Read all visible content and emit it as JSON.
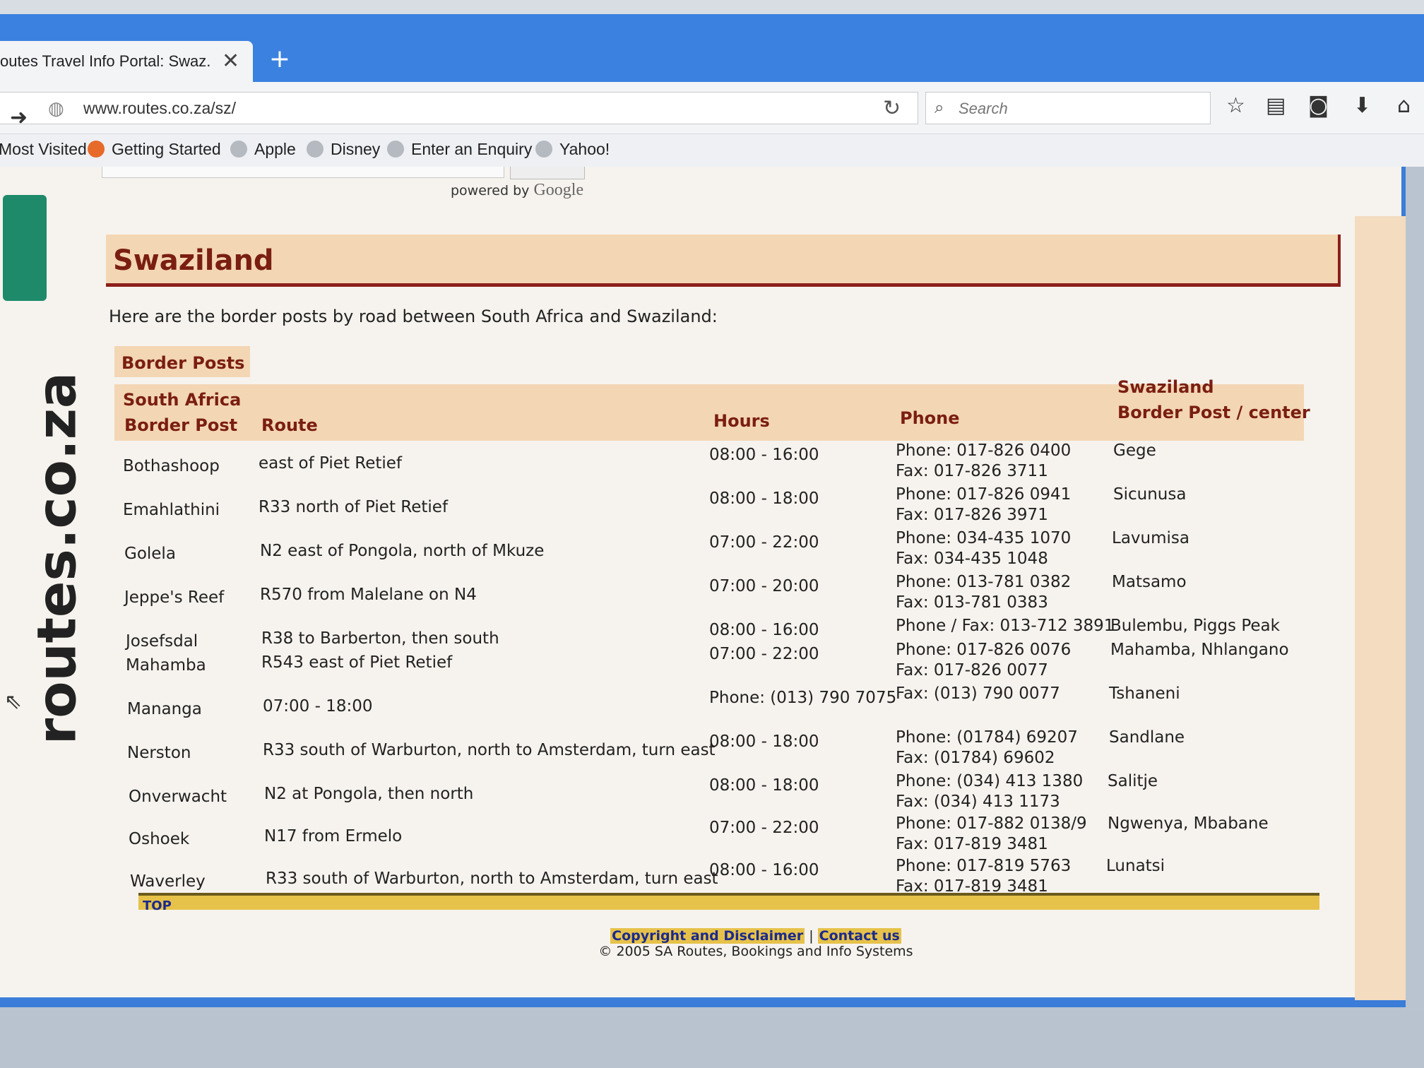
{
  "browser": {
    "tab_title": "outes Travel Info Portal: Swaz...",
    "new_tab": "+",
    "url": "www.routes.co.za/sz/",
    "search_placeholder": "Search",
    "bookmarks": [
      "Most Visited",
      "Getting Started",
      "Apple",
      "Disney",
      "Enter an Enquiry",
      "Yahoo!"
    ]
  },
  "powered_by": {
    "prefix": "powered by",
    "brand": "Google"
  },
  "logo": {
    "text": "routes.co.za"
  },
  "page": {
    "title": "Swaziland",
    "intro": "Here are the border posts by road between South Africa and Swaziland:"
  },
  "table": {
    "caption": "Border Posts",
    "group_sa": "South Africa",
    "group_sz": "Swaziland",
    "columns": [
      "Border Post",
      "Route",
      "Hours",
      "Phone",
      "Border Post / center"
    ],
    "rows": [
      {
        "post": "Bothashoop",
        "route": "east of Piet Retief",
        "hours": "08:00 - 16:00",
        "phone": "Phone: 017-826 0400",
        "fax": "Fax: 017-826 3711",
        "sz": "Gege"
      },
      {
        "post": "Emahlathini",
        "route": "R33 north of Piet Retief",
        "hours": "08:00 - 18:00",
        "phone": "Phone: 017-826 0941",
        "fax": "Fax: 017-826 3971",
        "sz": "Sicunusa"
      },
      {
        "post": "Golela",
        "route": "N2 east of Pongola, north of Mkuze",
        "hours": "07:00 - 22:00",
        "phone": "Phone: 034-435 1070",
        "fax": "Fax: 034-435 1048",
        "sz": "Lavumisa"
      },
      {
        "post": "Jeppe's Reef",
        "route": "R570 from Malelane on N4",
        "hours": "07:00 - 20:00",
        "phone": "Phone: 013-781 0382",
        "fax": "Fax: 013-781 0383",
        "sz": "Matsamo"
      },
      {
        "post": "Josefsdal",
        "route": "R38 to Barberton, then south",
        "hours": "08:00 - 16:00",
        "phone": "Phone / Fax: 013-712 3891",
        "fax": "",
        "sz": "Bulembu, Piggs Peak"
      },
      {
        "post": "Mahamba",
        "route": "R543 east of Piet Retief",
        "hours": "07:00 - 22:00",
        "phone": "Phone: 017-826 0076",
        "fax": "Fax: 017-826 0077",
        "sz": "Mahamba, Nhlangano"
      },
      {
        "post": "Mananga",
        "route": "07:00 - 18:00",
        "hours": "Phone: (013) 790 7075",
        "phone": "Fax: (013) 790 0077",
        "fax": "",
        "sz": "Tshaneni"
      },
      {
        "post": "Nerston",
        "route": "R33 south of Warburton, north to Amsterdam, turn east",
        "hours": "08:00 - 18:00",
        "phone": "Phone: (01784) 69207",
        "fax": "Fax: (01784) 69602",
        "sz": "Sandlane"
      },
      {
        "post": "Onverwacht",
        "route": "N2 at Pongola, then north",
        "hours": "08:00 - 18:00",
        "phone": "Phone: (034) 413 1380",
        "fax": "Fax: (034) 413 1173",
        "sz": "Salitje"
      },
      {
        "post": "Oshoek",
        "route": "N17 from Ermelo",
        "hours": "07:00 - 22:00",
        "phone": "Phone: 017-882 0138/9",
        "fax": "Fax: 017-819 3481",
        "sz": "Ngwenya, Mbabane"
      },
      {
        "post": "Waverley",
        "route": "R33 south of Warburton, north to Amsterdam, turn east",
        "hours": "08:00 - 16:00",
        "phone": "Phone: 017-819 5763",
        "fax": "Fax: 017-819 3481",
        "sz": "Lunatsi"
      }
    ]
  },
  "footer": {
    "top_link": "TOP",
    "copyright_link": "Copyright and Disclaimer",
    "separator": "|",
    "contact_link": "Contact us",
    "copyright_text": "© 2005 SA Routes, Bookings and Info Systems"
  },
  "colors": {
    "tabbar": "#3b82e0",
    "header_bg": "#f3d6b3",
    "header_text": "#7a1e12",
    "accent_yellow": "#e6c24a",
    "link_blue": "#1b2a8c"
  },
  "icons": [
    "forward-icon",
    "globe-icon",
    "reload-icon",
    "search-icon",
    "bookmark-star-icon",
    "reading-list-icon",
    "pocket-icon",
    "download-icon",
    "home-icon",
    "close-icon",
    "cursor-icon"
  ]
}
